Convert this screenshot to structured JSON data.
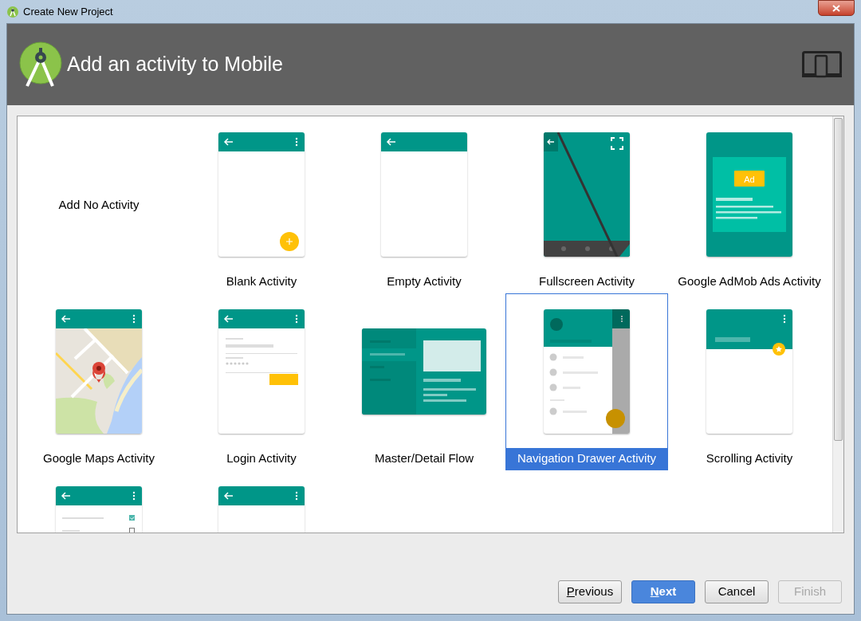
{
  "window": {
    "title": "Create New Project"
  },
  "header": {
    "title": "Add an activity to Mobile"
  },
  "items": [
    {
      "kind": "none",
      "label": "Add No Activity",
      "selected": false
    },
    {
      "kind": "blank",
      "label": "Blank Activity",
      "selected": false
    },
    {
      "kind": "empty",
      "label": "Empty Activity",
      "selected": false
    },
    {
      "kind": "fullscreen",
      "label": "Fullscreen Activity",
      "selected": false
    },
    {
      "kind": "admob",
      "label": "Google AdMob Ads Activity",
      "badge": "Ad",
      "selected": false
    },
    {
      "kind": "maps",
      "label": "Google Maps Activity",
      "selected": false
    },
    {
      "kind": "login",
      "label": "Login Activity",
      "selected": false
    },
    {
      "kind": "masterdetail",
      "label": "Master/Detail Flow",
      "selected": false
    },
    {
      "kind": "drawer",
      "label": "Navigation Drawer Activity",
      "selected": true
    },
    {
      "kind": "scrolling",
      "label": "Scrolling Activity",
      "selected": false
    },
    {
      "kind": "settings",
      "selected": false
    },
    {
      "kind": "plain",
      "selected": false
    }
  ],
  "buttons": [
    {
      "mnemonic": "P",
      "rest": "revious",
      "primary": false,
      "disabled": false
    },
    {
      "mnemonic": "N",
      "rest": "ext",
      "primary": true,
      "disabled": false
    },
    {
      "rest": "Cancel",
      "primary": false,
      "disabled": false
    },
    {
      "rest": "Finish",
      "primary": false,
      "disabled": true
    }
  ]
}
